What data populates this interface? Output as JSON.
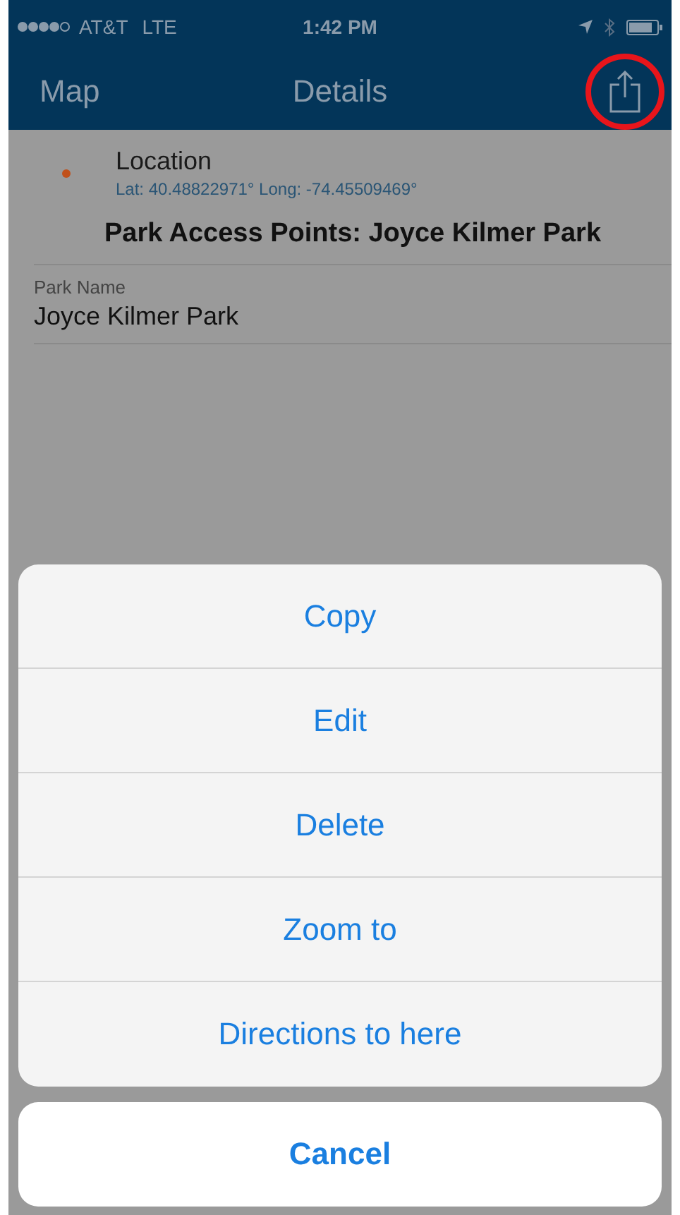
{
  "status_bar": {
    "carrier": "AT&T",
    "network": "LTE",
    "time": "1:42 PM"
  },
  "nav_bar": {
    "back": "Map",
    "title": "Details"
  },
  "location": {
    "label": "Location",
    "coords": "Lat: 40.48822971° Long: -74.45509469°",
    "color": "#c0501a"
  },
  "heading": "Park Access Points: Joyce Kilmer Park",
  "fields": [
    {
      "label": "Park Name",
      "value": "Joyce Kilmer Park"
    }
  ],
  "action_sheet": {
    "actions": [
      "Copy",
      "Edit",
      "Delete",
      "Zoom to",
      "Directions to here"
    ],
    "cancel": "Cancel"
  }
}
